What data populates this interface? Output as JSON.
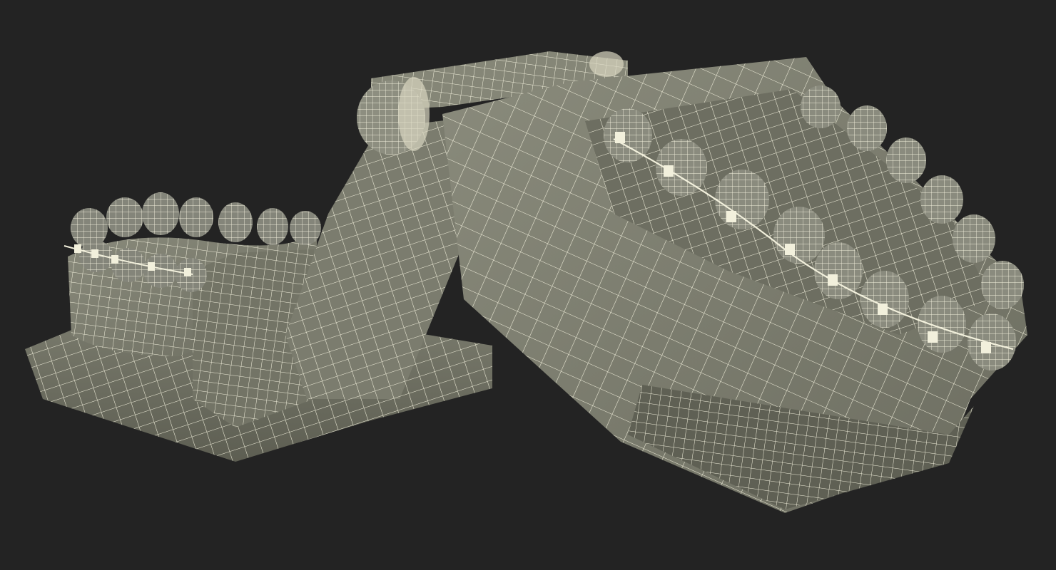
{
  "scene": {
    "kind": "3d-wireframe-render",
    "subject_icon": "dental-model-with-braces-icon",
    "background_color": "#232323",
    "surface_color": "#7e7f70",
    "surface_shadow_color": "#56574b",
    "wire_color": "#f2f0dc",
    "parts": [
      {
        "name": "lower-jaw",
        "icon": "lower-jaw-icon"
      },
      {
        "name": "upper-jaw",
        "icon": "upper-jaw-icon"
      },
      {
        "name": "hinge-articulator",
        "icon": "hinge-icon"
      },
      {
        "name": "orthodontic-braces",
        "icon": "braces-icon"
      }
    ]
  }
}
